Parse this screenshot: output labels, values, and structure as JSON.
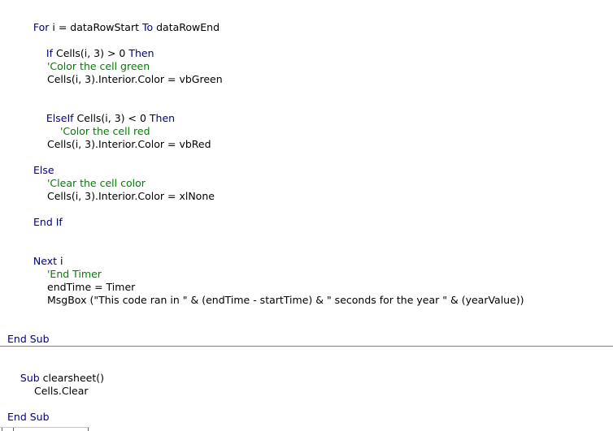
{
  "code": {
    "for_kw": "For",
    "for_mid": " i = dataRowStart ",
    "to_kw": "To",
    "for_end": " dataRowEnd",
    "if_kw": "If",
    "if_cond": " Cells(i, 3) > 0 ",
    "then_kw": "Then",
    "comment_green": "'Color the cell green",
    "assign_green": "Cells(i, 3).Interior.Color = vbGreen",
    "elseif_kw": "ElseIf",
    "elseif_cond": " Cells(i, 3) < 0 ",
    "then_kw2": "Then",
    "comment_red": "'Color the cell red",
    "assign_red": "Cells(i, 3).Interior.Color = vbRed",
    "else_kw": "Else",
    "comment_clear": "'Clear the cell color",
    "assign_clear": "Cells(i, 3).Interior.Color = xlNone",
    "endif_kw": "End If",
    "next_kw": "Next",
    "next_var": " i",
    "comment_timer": "'End Timer",
    "end_time": "endTime = Timer",
    "msgbox": "MsgBox (\"This code ran in \" & (endTime - startTime) & \" seconds for the year \" & (yearValue))",
    "end_sub_1": "End Sub",
    "sub_kw": "Sub",
    "sub_name": " clearsheet()",
    "cells_clear": "Cells.Clear",
    "end_sub_2": "End Sub"
  },
  "colors": {
    "keyword": "#000080",
    "comment": "#008000",
    "text": "#000000",
    "separator": "#808080"
  }
}
